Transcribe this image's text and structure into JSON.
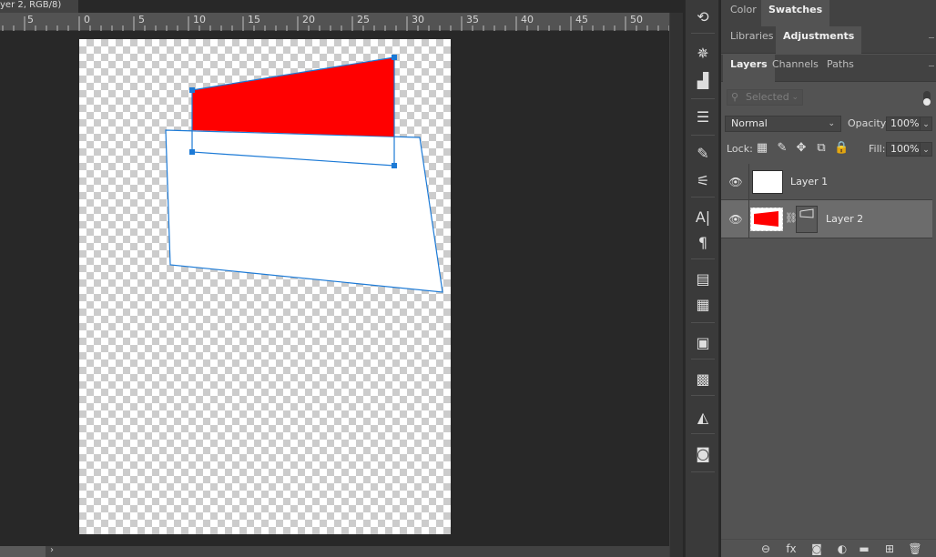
{
  "document": {
    "tab_title": "yer 2, RGB/8)",
    "close_glyph": "×"
  },
  "ruler": {
    "labels": [
      "5",
      "0",
      "5",
      "10",
      "15",
      "20",
      "25",
      "30",
      "35",
      "40",
      "45",
      "50"
    ]
  },
  "status_bar": {
    "arrow": "›"
  },
  "icon_strip": {
    "items": [
      {
        "name": "history-icon",
        "glyph": "⟲"
      },
      {
        "name": "navigator-icon",
        "glyph": "✵"
      },
      {
        "name": "histogram-icon",
        "glyph": "▟"
      },
      {
        "name": "adjustments-icon",
        "glyph": "☰"
      },
      {
        "name": "brushes-icon",
        "glyph": "✎"
      },
      {
        "name": "brush-settings-icon",
        "glyph": "⚟"
      },
      {
        "name": "character-icon",
        "glyph": "A|"
      },
      {
        "name": "paragraph-icon",
        "glyph": "¶"
      },
      {
        "name": "properties-icon",
        "glyph": "▤"
      },
      {
        "name": "notes-icon",
        "glyph": "▦"
      },
      {
        "name": "gradients-icon",
        "glyph": "▣"
      },
      {
        "name": "patterns-icon",
        "glyph": "▩"
      },
      {
        "name": "actions-icon",
        "glyph": "◭"
      },
      {
        "name": "camera-raw-icon",
        "glyph": "◙"
      }
    ]
  },
  "panels": {
    "row1_tabs": [
      "Color",
      "Swatches"
    ],
    "row1_active": "Swatches",
    "row2_tabs": [
      "Libraries",
      "Adjustments"
    ],
    "row2_active": "Adjustments",
    "row3_tabs": [
      "Layers",
      "Channels",
      "Paths"
    ],
    "row3_active": "Layers"
  },
  "layers_panel": {
    "filter_placeholder": "Selected",
    "search_glyph": "⚲",
    "chevron_glyph": "⌄",
    "blend_mode": "Normal",
    "opacity_label": "Opacity:",
    "opacity_value": "100%",
    "lock_label": "Lock:",
    "lock_icons": [
      {
        "name": "lock-transparent-pixels-icon",
        "glyph": "▦"
      },
      {
        "name": "lock-image-pixels-icon",
        "glyph": "✎"
      },
      {
        "name": "lock-position-icon",
        "glyph": "✥"
      },
      {
        "name": "lock-artboard-icon",
        "glyph": "⧉"
      },
      {
        "name": "lock-all-icon",
        "glyph": "🔒"
      }
    ],
    "fill_label": "Fill:",
    "fill_value": "100%",
    "eye_glyph": "👁",
    "layers": [
      {
        "name": "Layer 1",
        "selected": false,
        "thumb_color": "#ffffff"
      },
      {
        "name": "Layer 2",
        "selected": true,
        "thumb_color": "#ff0000"
      }
    ]
  },
  "footer": {
    "icons": [
      {
        "name": "link-layers-icon",
        "glyph": "⊖"
      },
      {
        "name": "layer-style-icon",
        "glyph": "fx"
      },
      {
        "name": "add-mask-icon",
        "glyph": "◙"
      },
      {
        "name": "new-adjustment-icon",
        "glyph": "◐"
      },
      {
        "name": "new-group-icon",
        "glyph": "▬"
      },
      {
        "name": "new-layer-icon",
        "glyph": "⊞"
      },
      {
        "name": "delete-layer-icon",
        "glyph": "🗑"
      }
    ]
  },
  "colors": {
    "shape_red": "#ff0000",
    "selection_blue": "#1c7ad6",
    "canvas_bg": "#282828",
    "panel_bg": "#535353"
  }
}
